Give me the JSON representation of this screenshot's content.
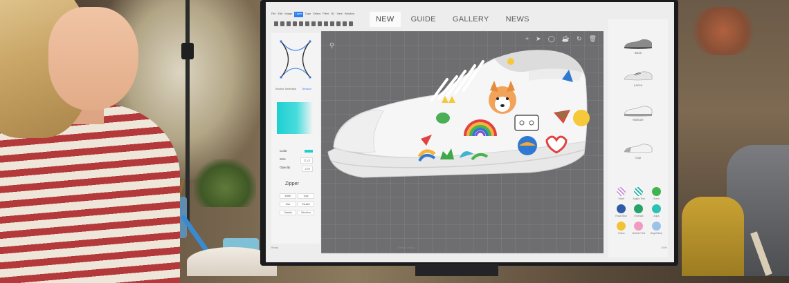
{
  "app": {
    "menu": [
      "File",
      "Edit",
      "Image",
      "Layer",
      "Type",
      "Select",
      "Filter",
      "3D",
      "View",
      "Window"
    ],
    "active_menu_index": 3,
    "tabs": [
      {
        "label": "NEW",
        "active": true
      },
      {
        "label": "GUIDE",
        "active": false
      },
      {
        "label": "GALLERY",
        "active": false
      },
      {
        "label": "NEWS",
        "active": false
      }
    ]
  },
  "left_panel": {
    "curve_caption": "Anchor Selection",
    "curve_caption_link": "Tension",
    "gradient_start": "#1ecfd0",
    "properties": [
      {
        "label": "Color",
        "value": ""
      },
      {
        "label": "Size",
        "value": "11 pt"
      },
      {
        "label": "Opacity",
        "value": "100"
      }
    ],
    "section_title": "Zipper",
    "section_buttons": [
      "Width",
      "Type",
      "Size",
      "Parallel",
      "Opacity",
      "Direction"
    ]
  },
  "canvas": {
    "tools": [
      "plus-icon",
      "pointer-icon",
      "lasso-icon",
      "cup-icon",
      "rotate-icon",
      "trash-icon"
    ]
  },
  "right_panel": {
    "styles": [
      "Base",
      "Laces",
      "Midsole",
      "Cap"
    ],
    "colors": [
      {
        "name": "Violet",
        "hex": "#c99be0",
        "style": "pattern"
      },
      {
        "name": "Argyle Teal",
        "hex": "#2fb4a6",
        "style": "pattern"
      },
      {
        "name": "Green",
        "hex": "#3fb44f",
        "style": "solid"
      },
      {
        "name": "Royal Blue",
        "hex": "#2f5aa8",
        "style": "solid"
      },
      {
        "name": "Emerald",
        "hex": "#25a36b",
        "style": "solid"
      },
      {
        "name": "Aqua",
        "hex": "#2cc1b2",
        "style": "solid"
      },
      {
        "name": "Yellow",
        "hex": "#f1c232",
        "style": "solid"
      },
      {
        "name": "Bubble Pink",
        "hex": "#f39ac3",
        "style": "solid"
      },
      {
        "name": "Bright Blue",
        "hex": "#9cc2ea",
        "style": "solid"
      }
    ]
  },
  "status": {
    "left": "Ready",
    "middle": "Sneaker Design",
    "right": "100%"
  }
}
